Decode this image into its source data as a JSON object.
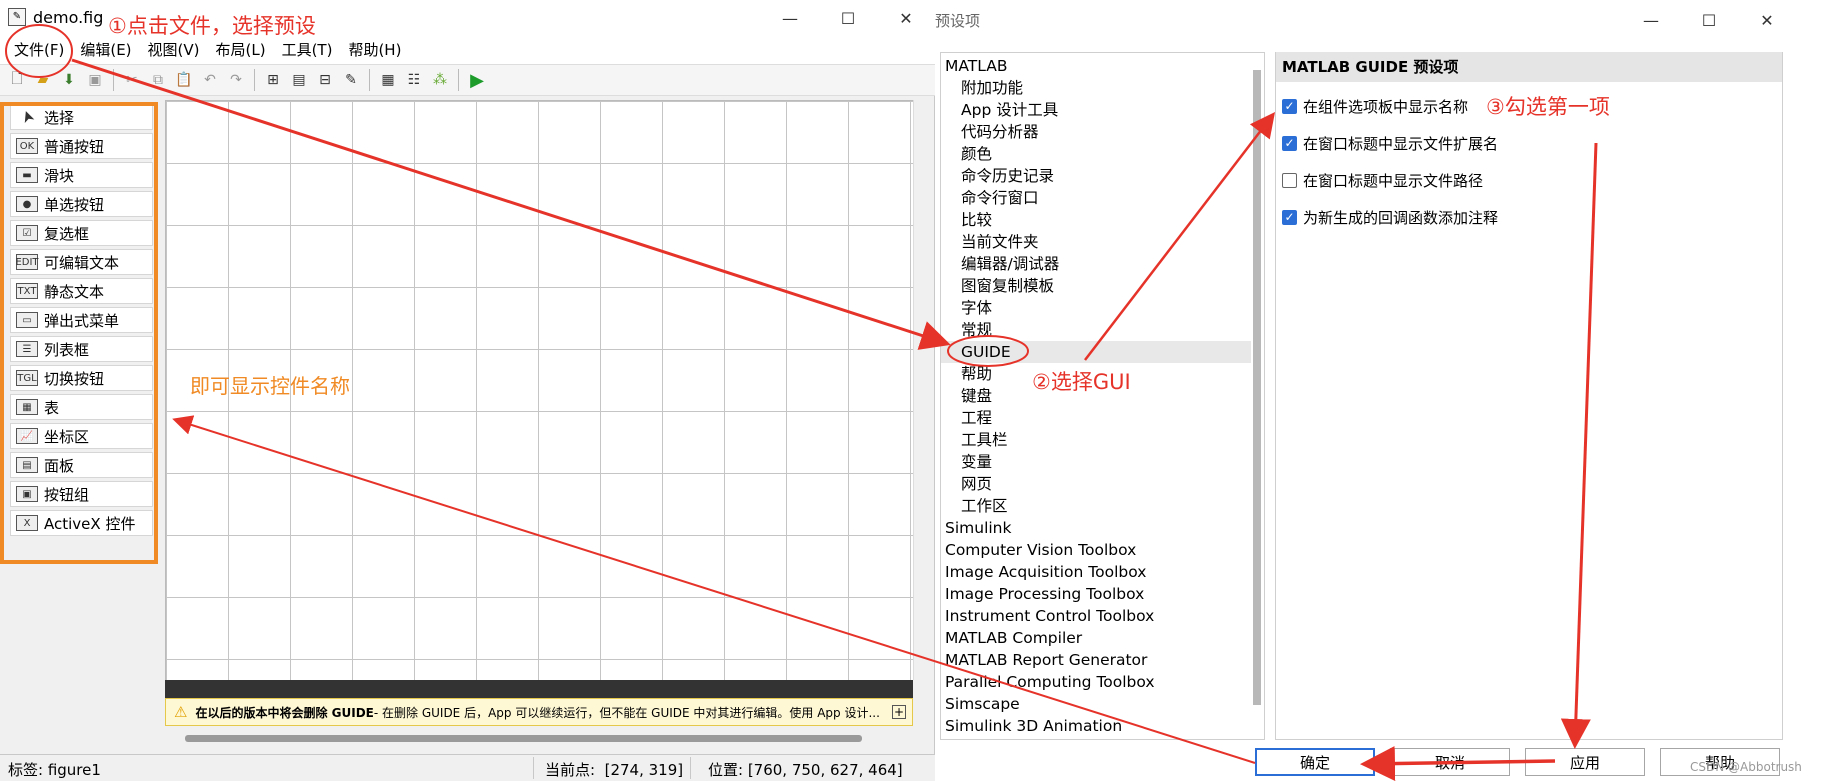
{
  "left_window": {
    "title": "demo.fig",
    "window_controls": [
      "—",
      "☐",
      "✕"
    ],
    "menus": [
      "文件(F)",
      "编辑(E)",
      "视图(V)",
      "布局(L)",
      "工具(T)",
      "帮助(H)"
    ],
    "palette": [
      {
        "label": "选择",
        "icon": "pointer-icon"
      },
      {
        "label": "普通按钮",
        "icon": "push-button-icon",
        "icon_text": "OK"
      },
      {
        "label": "滑块",
        "icon": "slider-icon",
        "icon_text": "▬"
      },
      {
        "label": "单选按钮",
        "icon": "radio-button-icon",
        "icon_text": "●"
      },
      {
        "label": "复选框",
        "icon": "checkbox-icon",
        "icon_text": "☑"
      },
      {
        "label": "可编辑文本",
        "icon": "edit-text-icon",
        "icon_text": "EDIT"
      },
      {
        "label": "静态文本",
        "icon": "static-text-icon",
        "icon_text": "TXT"
      },
      {
        "label": "弹出式菜单",
        "icon": "popup-menu-icon",
        "icon_text": "▭"
      },
      {
        "label": "列表框",
        "icon": "listbox-icon",
        "icon_text": "☰"
      },
      {
        "label": "切换按钮",
        "icon": "toggle-button-icon",
        "icon_text": "TGL"
      },
      {
        "label": "表",
        "icon": "table-icon",
        "icon_text": "▦"
      },
      {
        "label": "坐标区",
        "icon": "axes-icon",
        "icon_text": "📈"
      },
      {
        "label": "面板",
        "icon": "panel-icon",
        "icon_text": "▤"
      },
      {
        "label": "按钮组",
        "icon": "button-group-icon",
        "icon_text": "▣"
      },
      {
        "label": "ActiveX 控件",
        "icon": "activex-icon",
        "icon_text": "X"
      }
    ],
    "warning_bold": "在以后的版本中将会删除 GUIDE",
    "warning_text": " - 在删除 GUIDE 后，App 可以继续运行，但不能在 GUIDE 中对其进行编辑。使用 App 设计...",
    "status": {
      "tag": "标签: figure1",
      "current_point": "当前点:  [274, 319]",
      "position": "位置: [760, 750, 627, 464]"
    }
  },
  "right_window": {
    "title": "预设项",
    "window_controls": [
      "—",
      "☐",
      "✕"
    ],
    "tree": [
      {
        "label": "MATLAB",
        "level": 0
      },
      {
        "label": "附加功能",
        "level": 1
      },
      {
        "label": "App 设计工具",
        "level": 1
      },
      {
        "label": "代码分析器",
        "level": 1
      },
      {
        "label": "颜色",
        "level": 1
      },
      {
        "label": "命令历史记录",
        "level": 1
      },
      {
        "label": "命令行窗口",
        "level": 1
      },
      {
        "label": "比较",
        "level": 1
      },
      {
        "label": "当前文件夹",
        "level": 1
      },
      {
        "label": "编辑器/调试器",
        "level": 1
      },
      {
        "label": "图窗复制模板",
        "level": 1
      },
      {
        "label": "字体",
        "level": 1
      },
      {
        "label": "常规",
        "level": 1
      },
      {
        "label": "GUIDE",
        "level": 1,
        "selected": true
      },
      {
        "label": "帮助",
        "level": 1
      },
      {
        "label": "键盘",
        "level": 1
      },
      {
        "label": "工程",
        "level": 1
      },
      {
        "label": "工具栏",
        "level": 1
      },
      {
        "label": "变量",
        "level": 1
      },
      {
        "label": "网页",
        "level": 1
      },
      {
        "label": "工作区",
        "level": 1
      },
      {
        "label": "Simulink",
        "level": 0
      },
      {
        "label": "Computer Vision Toolbox",
        "level": 0
      },
      {
        "label": "Image Acquisition Toolbox",
        "level": 0
      },
      {
        "label": "Image Processing Toolbox",
        "level": 0
      },
      {
        "label": "Instrument Control Toolbox",
        "level": 0
      },
      {
        "label": "MATLAB Compiler",
        "level": 0
      },
      {
        "label": "MATLAB Report Generator",
        "level": 0
      },
      {
        "label": "Parallel Computing Toolbox",
        "level": 0
      },
      {
        "label": "Simscape",
        "level": 0
      },
      {
        "label": "Simulink 3D Animation",
        "level": 0
      }
    ],
    "panel_title": "MATLAB GUIDE 预设项",
    "options": [
      {
        "label": "在组件选项板中显示名称",
        "checked": true
      },
      {
        "label": "在窗口标题中显示文件扩展名",
        "checked": true
      },
      {
        "label": "在窗口标题中显示文件路径",
        "checked": false
      },
      {
        "label": "为新生成的回调函数添加注释",
        "checked": true
      }
    ],
    "buttons": {
      "ok": "确定",
      "cancel": "取消",
      "apply": "应用",
      "help": "帮助"
    }
  },
  "annotations": {
    "step1": "①点击文件，选择预设",
    "step2": "②选择GUI",
    "step3": "③勾选第一项",
    "result": "即可显示控件名称",
    "watermark": "CSDN @Abbotrush"
  },
  "colors": {
    "annotation_red": "#e6332a",
    "annotation_orange": "#f08a24",
    "checkbox_blue": "#2b6fd6"
  }
}
